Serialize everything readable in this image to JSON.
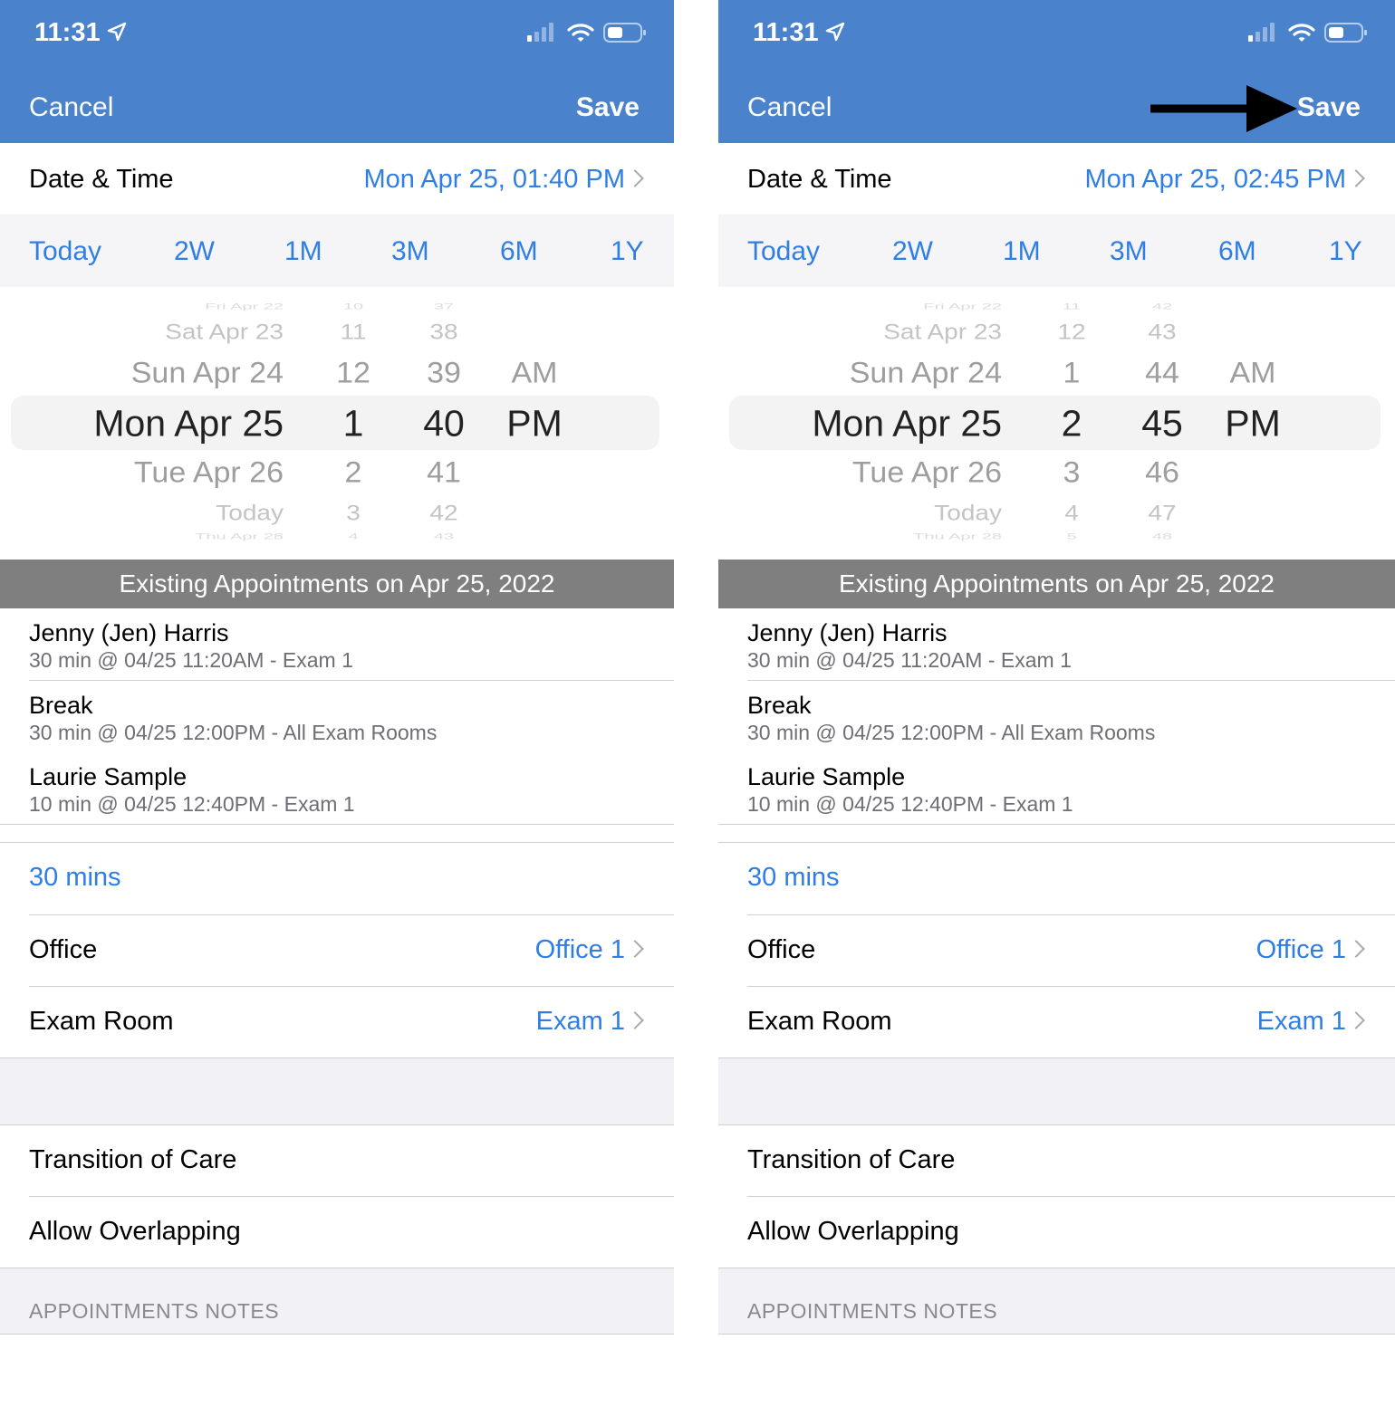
{
  "colors": {
    "accent": "#4a82cc",
    "link": "#2f7ee6",
    "section_header": "#7f7f7f"
  },
  "panels": [
    {
      "status": {
        "time": "11:31",
        "icons": [
          "location-arrow-icon",
          "cellular-signal-icon",
          "wifi-icon",
          "battery-icon"
        ]
      },
      "nav": {
        "cancel": "Cancel",
        "save": "Save",
        "arrow": false
      },
      "date_time": {
        "label": "Date & Time",
        "value": "Mon Apr 25, 01:40 PM"
      },
      "quick_ranges": [
        "Today",
        "2W",
        "1M",
        "3M",
        "6M",
        "1Y"
      ],
      "picker": {
        "dates": [
          "Fri Apr 22",
          "Sat Apr 23",
          "Sun Apr 24",
          "Mon Apr 25",
          "Tue Apr 26",
          "Today",
          "Thu Apr 28"
        ],
        "hours": [
          "10",
          "11",
          "12",
          "1",
          "2",
          "3",
          "4"
        ],
        "minutes": [
          "37",
          "38",
          "39",
          "40",
          "41",
          "42",
          "43"
        ],
        "ampm": [
          "",
          "",
          "AM",
          "PM",
          "",
          "",
          ""
        ]
      },
      "section_header": "Existing Appointments on Apr 25, 2022",
      "appointments": [
        {
          "name": "Jenny (Jen) Harris",
          "detail": "30 min @ 04/25 11:20AM - Exam 1"
        },
        {
          "name": "Break",
          "detail": "30 min @ 04/25 12:00PM - All Exam Rooms"
        },
        {
          "name": "Laurie Sample",
          "detail": "10 min @ 04/25 12:40PM - Exam 1"
        }
      ],
      "duration": "30 mins",
      "office": {
        "label": "Office",
        "value": "Office 1"
      },
      "exam_room": {
        "label": "Exam Room",
        "value": "Exam 1"
      },
      "transition_of_care": "Transition of Care",
      "allow_overlapping": "Allow Overlapping",
      "notes_header": "APPOINTMENTS NOTES"
    },
    {
      "status": {
        "time": "11:31",
        "icons": [
          "location-arrow-icon",
          "cellular-signal-icon",
          "wifi-icon",
          "battery-icon"
        ]
      },
      "nav": {
        "cancel": "Cancel",
        "save": "Save",
        "arrow": true
      },
      "date_time": {
        "label": "Date & Time",
        "value": "Mon Apr 25, 02:45 PM"
      },
      "quick_ranges": [
        "Today",
        "2W",
        "1M",
        "3M",
        "6M",
        "1Y"
      ],
      "picker": {
        "dates": [
          "Fri Apr 22",
          "Sat Apr 23",
          "Sun Apr 24",
          "Mon Apr 25",
          "Tue Apr 26",
          "Today",
          "Thu Apr 28"
        ],
        "hours": [
          "11",
          "12",
          "1",
          "2",
          "3",
          "4",
          "5"
        ],
        "minutes": [
          "42",
          "43",
          "44",
          "45",
          "46",
          "47",
          "48"
        ],
        "ampm": [
          "",
          "",
          "AM",
          "PM",
          "",
          "",
          ""
        ]
      },
      "section_header": "Existing Appointments on Apr 25, 2022",
      "appointments": [
        {
          "name": "Jenny (Jen) Harris",
          "detail": "30 min @ 04/25 11:20AM - Exam 1"
        },
        {
          "name": "Break",
          "detail": "30 min @ 04/25 12:00PM - All Exam Rooms"
        },
        {
          "name": "Laurie Sample",
          "detail": "10 min @ 04/25 12:40PM - Exam 1"
        }
      ],
      "duration": "30 mins",
      "office": {
        "label": "Office",
        "value": "Office 1"
      },
      "exam_room": {
        "label": "Exam Room",
        "value": "Exam 1"
      },
      "transition_of_care": "Transition of Care",
      "allow_overlapping": "Allow Overlapping",
      "notes_header": "APPOINTMENTS NOTES"
    }
  ]
}
